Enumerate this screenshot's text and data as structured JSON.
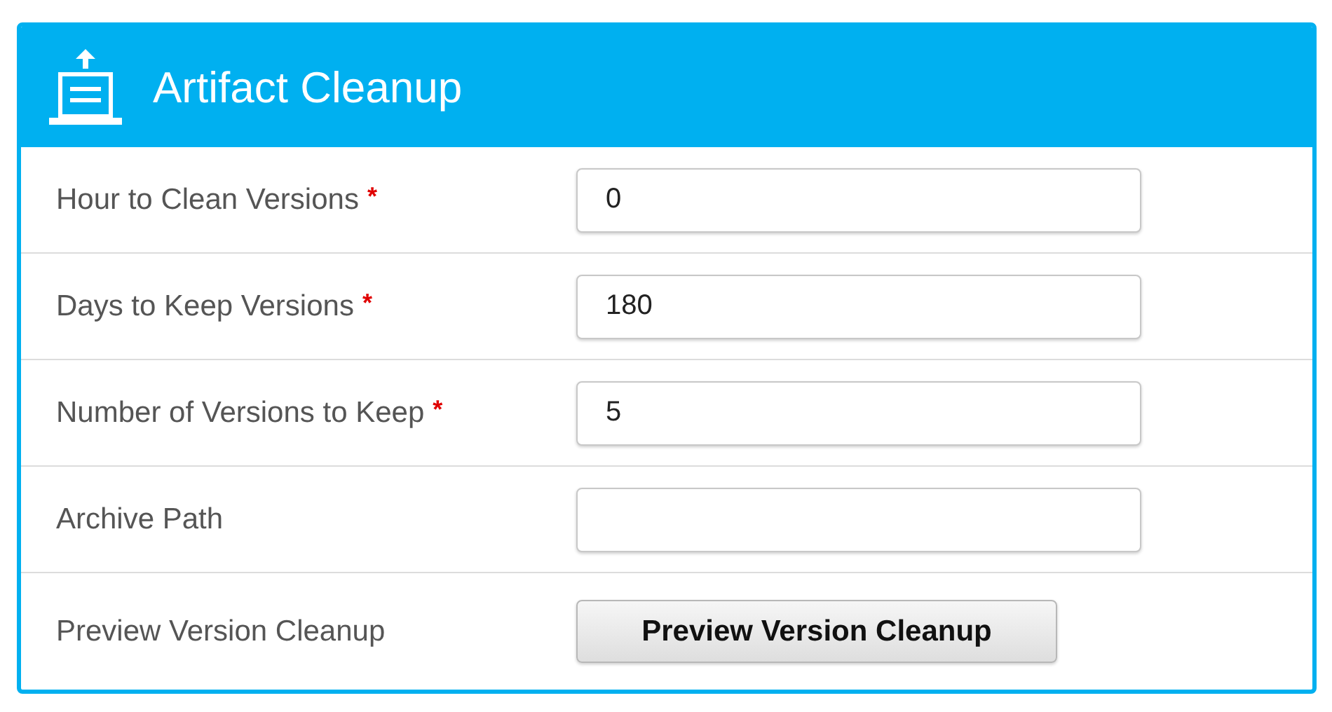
{
  "panel": {
    "title": "Artifact Cleanup"
  },
  "rows": [
    {
      "kind": "field",
      "label": "Hour to Clean Versions",
      "required_mark": "*",
      "value": "0"
    },
    {
      "kind": "field",
      "label": "Days to Keep Versions",
      "required_mark": "*",
      "value": "180"
    },
    {
      "kind": "field",
      "label": "Number of Versions to Keep",
      "required_mark": "*",
      "value": "5"
    },
    {
      "kind": "field",
      "label": "Archive Path"
    },
    {
      "kind": "button",
      "label": "Preview Version Cleanup",
      "button": "Preview Version Cleanup"
    }
  ]
}
